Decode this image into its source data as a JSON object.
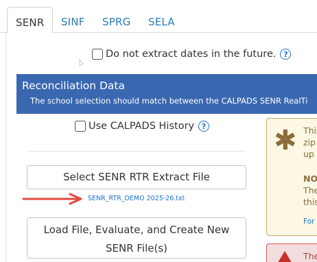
{
  "tabs": [
    {
      "label": "SENR",
      "active": true
    },
    {
      "label": "SINF",
      "active": false
    },
    {
      "label": "SPRG",
      "active": false
    },
    {
      "label": "SELA",
      "active": false
    }
  ],
  "options": {
    "no_future_dates_label": "Do not extract dates in the future.",
    "no_future_dates_checked": false,
    "use_history_label": "Use CALPADS History",
    "use_history_checked": false,
    "help_glyph": "?"
  },
  "banner": {
    "title": "Reconciliation Data",
    "subtitle": "The school selection should match between the CALPADS SENR RealTi"
  },
  "buttons": {
    "select_file": "Select SENR RTR Extract File",
    "load_line1": "Load File, Evaluate, and Create New",
    "load_line2": "SENR File(s)"
  },
  "selected_file": "SENR_RTR_DEMO 2025-26.txt",
  "notice": {
    "icon": "asterisk-icon",
    "lines": [
      "This",
      "zip",
      "up t"
    ],
    "note_lines": [
      "NOT",
      "The",
      "this"
    ],
    "link": "For"
  },
  "alert": {
    "icon": "warning-icon",
    "text": "The"
  },
  "colors": {
    "banner": "#3a68b0",
    "link": "#1f6fd1",
    "arrow": "#e04a3f",
    "notice_bg": "#fcf8e3",
    "alert_bg": "#f2dede"
  }
}
